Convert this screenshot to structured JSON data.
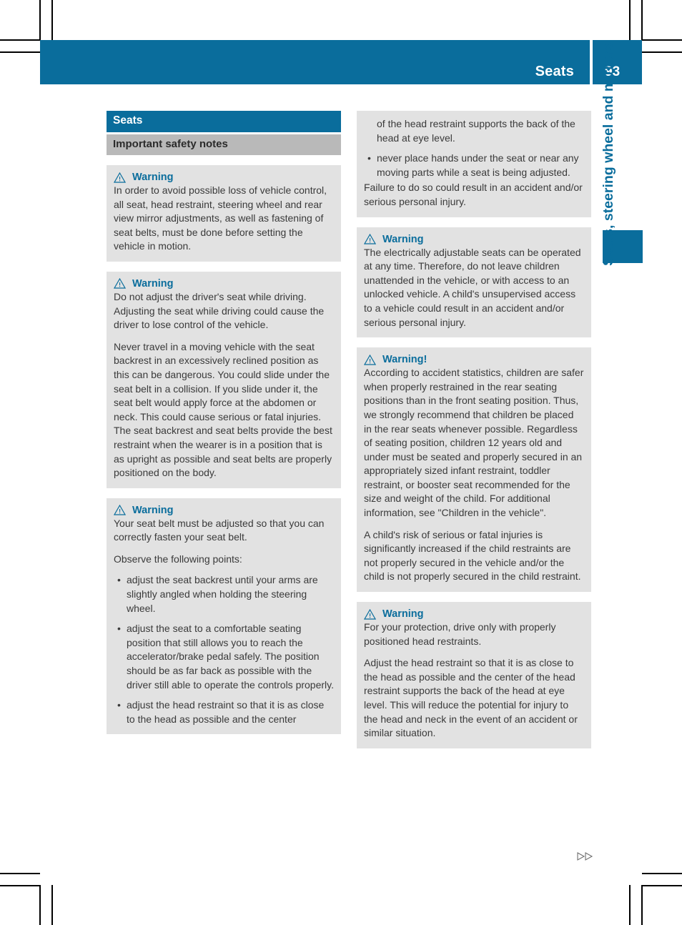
{
  "colors": {
    "brand_blue": "#0a6d9c",
    "subhead_grey": "#b9b9b9",
    "box_grey": "#e2e2e2",
    "text_grey": "#3a3a3a"
  },
  "header": {
    "title": "Seats",
    "page_number": "93"
  },
  "thumb_tab": {
    "label": "Seats, steering wheel and mirrors"
  },
  "icons": {
    "warning_triangle": "warning-triangle-icon",
    "continue_arrows": "double-triangle-continue-icon"
  },
  "left_column": {
    "section_heading": "Seats",
    "sub_heading": "Important safety notes",
    "boxes": [
      {
        "label": "Warning",
        "paragraphs": [
          "In order to avoid possible loss of vehicle control, all seat, head restraint, steering wheel and rear view mirror adjustments, as well as fastening of seat belts, must be done before setting the vehicle in motion."
        ],
        "bullets": []
      },
      {
        "label": "Warning",
        "paragraphs": [
          "Do not adjust the driver's seat while driving. Adjusting the seat while driving could cause the driver to lose control of the vehicle.",
          "Never travel in a moving vehicle with the seat backrest in an excessively reclined position as this can be dangerous. You could slide under the seat belt in a collision. If you slide under it, the seat belt would apply force at the abdomen or neck. This could cause serious or fatal injuries. The seat backrest and seat belts provide the best restraint when the wearer is in a position that is as upright as possible and seat belts are properly positioned on the body."
        ],
        "bullets": []
      },
      {
        "label": "Warning",
        "paragraphs": [
          "Your seat belt must be adjusted so that you can correctly fasten your seat belt.",
          "Observe the following points:"
        ],
        "bullets": [
          "adjust the seat backrest until your arms are slightly angled when holding the steering wheel.",
          "adjust the seat to a comfortable seating position that still allows you to reach the accelerator/brake pedal safely. The position should be as far back as possible with the driver still able to operate the controls properly.",
          "adjust the head restraint so that it is as close to the head as possible and the center"
        ]
      }
    ]
  },
  "right_column": {
    "boxes": [
      {
        "label": "",
        "continued": true,
        "lead_lines": "of the head restraint supports the back of the head at eye level.",
        "bullets": [
          "never place hands under the seat or near any moving parts while a seat is being adjusted."
        ],
        "paragraphs": [
          "Failure to do so could result in an accident and/or serious personal injury."
        ]
      },
      {
        "label": "Warning",
        "continued": false,
        "paragraphs": [
          "The electrically adjustable seats can be operated at any time. Therefore, do not leave children unattended in the vehicle, or with access to an unlocked vehicle. A child's unsupervised access to a vehicle could result in an accident and/or serious personal injury."
        ],
        "bullets": []
      },
      {
        "label": "Warning!",
        "continued": false,
        "paragraphs": [
          "According to accident statistics, children are safer when properly restrained in the rear seating positions than in the front seating position. Thus, we strongly recommend that children be placed in the rear seats whenever possible. Regardless of seating position, children 12 years old and under must be seated and properly secured in an appropriately sized infant restraint, toddler restraint, or booster seat recommended for the size and weight of the child. For additional information, see \"Children in the vehicle\".",
          "A child's risk of serious or fatal injuries is significantly increased if the child restraints are not properly secured in the vehicle and/or the child is not properly secured in the child restraint."
        ],
        "bullets": []
      },
      {
        "label": "Warning",
        "continued": false,
        "paragraphs": [
          "For your protection, drive only with properly positioned head restraints.",
          "Adjust the head restraint so that it is as close to the head as possible and the center of the head restraint supports the back of the head at eye level. This will reduce the potential for injury to the head and neck in the event of an accident or similar situation."
        ],
        "bullets": []
      }
    ]
  },
  "bullet_glyph": "•"
}
